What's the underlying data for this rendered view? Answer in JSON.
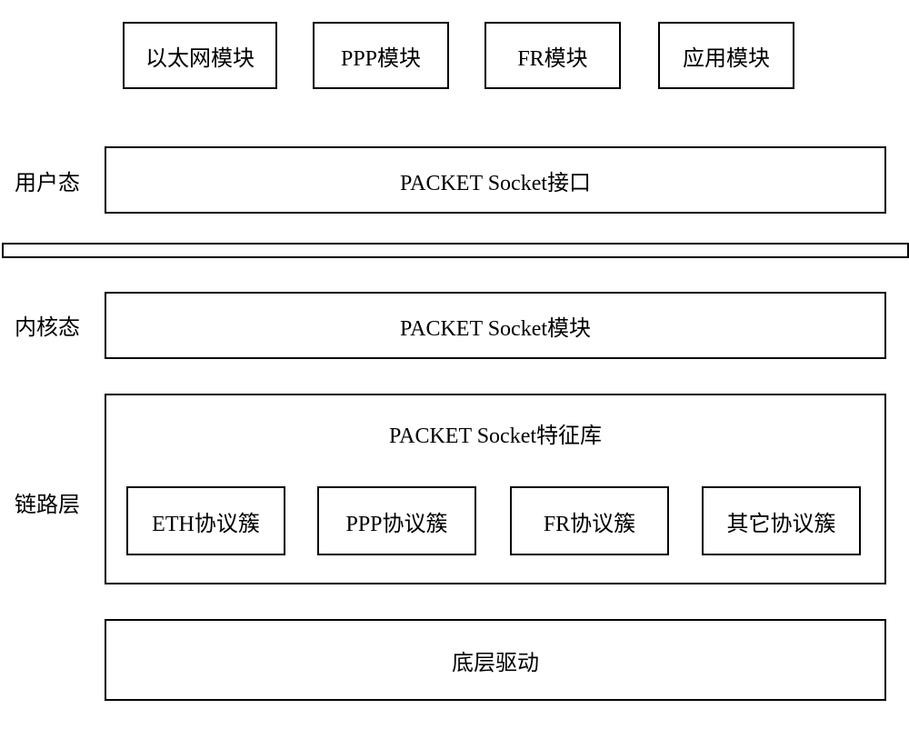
{
  "topModules": {
    "ethernet": "以太网模块",
    "ppp": "PPP模块",
    "fr": "FR模块",
    "app": "应用模块"
  },
  "labels": {
    "userMode": "用户态",
    "kernelMode": "内核态",
    "linkLayer": "链路层"
  },
  "layers": {
    "packetSocketInterface": "PACKET Socket接口",
    "packetSocketModule": "PACKET Socket模块",
    "packetSocketFeatureLib": "PACKET Socket特征库",
    "bottomDriver": "底层驱动"
  },
  "protocolClusters": {
    "eth": "ETH协议簇",
    "ppp": "PPP协议簇",
    "fr": "FR协议簇",
    "other": "其它协议簇"
  }
}
